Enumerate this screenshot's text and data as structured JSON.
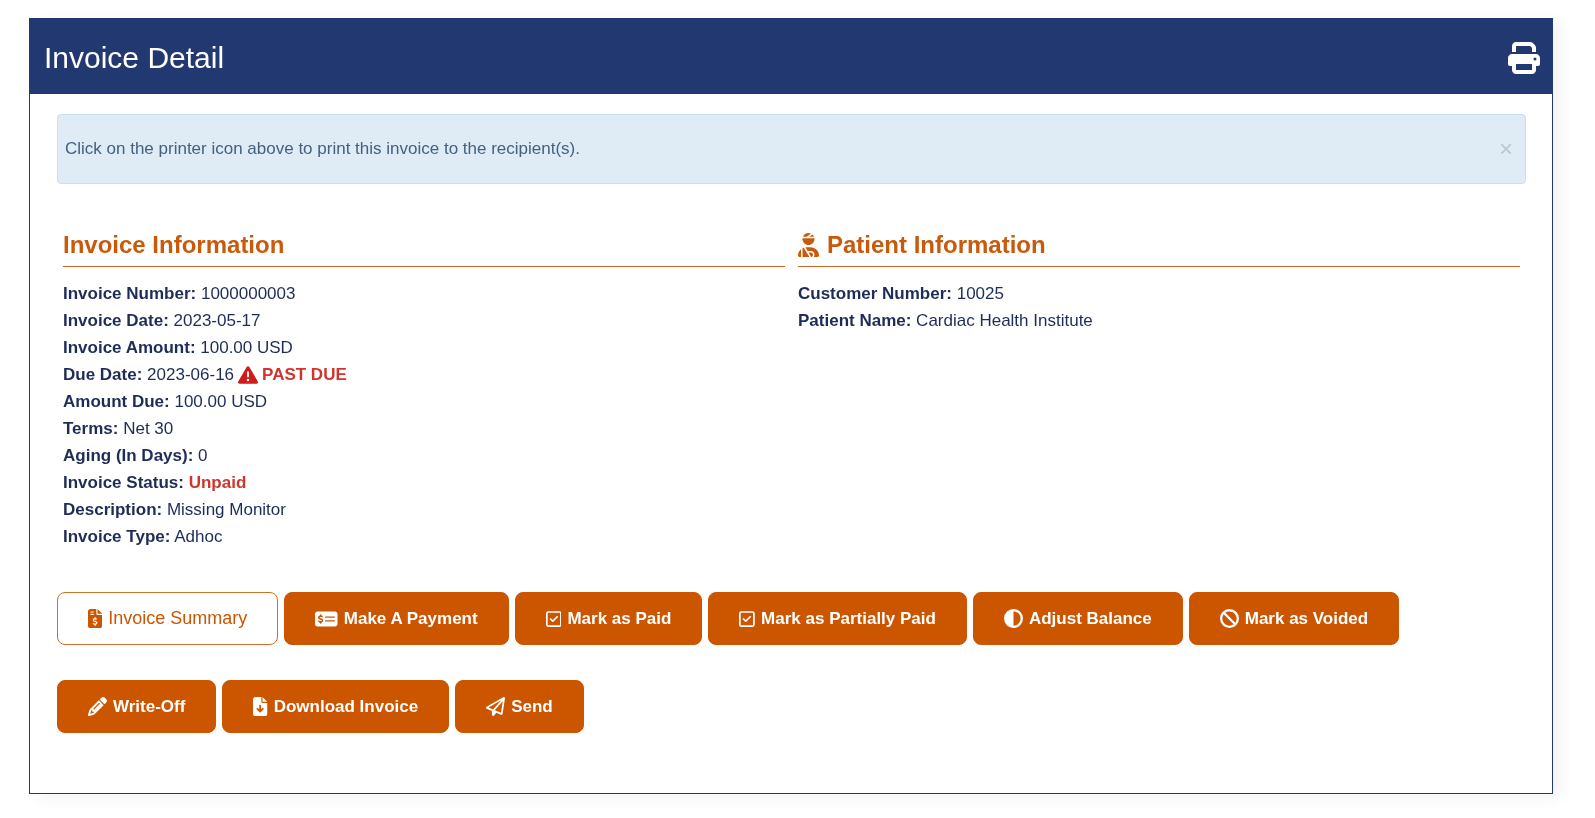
{
  "header": {
    "title": "Invoice Detail"
  },
  "alert": {
    "message": "Click on the printer icon above to print this invoice to the recipient(s).",
    "close": "×"
  },
  "sections": [
    {
      "kind": "invoice",
      "title": "Invoice Information",
      "fields": [
        {
          "kind": "text",
          "label": "Invoice Number:",
          "value": "1000000003"
        },
        {
          "kind": "text",
          "label": "Invoice Date:",
          "value": "2023-05-17"
        },
        {
          "kind": "text",
          "label": "Invoice Amount:",
          "value": "100.00 USD"
        },
        {
          "kind": "overdue",
          "label": "Due Date:",
          "value": "2023-06-16",
          "note": "PAST DUE"
        },
        {
          "kind": "text",
          "label": "Amount Due:",
          "value": "100.00 USD"
        },
        {
          "kind": "text",
          "label": "Terms:",
          "value": "Net 30"
        },
        {
          "kind": "text",
          "label": "Aging (In Days):",
          "value": "0"
        },
        {
          "kind": "status",
          "label": "Invoice Status:",
          "value": "Unpaid"
        },
        {
          "kind": "text",
          "label": "Description:",
          "value": "Missing Monitor"
        },
        {
          "kind": "text",
          "label": "Invoice Type:",
          "value": "Adhoc"
        }
      ]
    },
    {
      "kind": "patient",
      "title": "Patient Information",
      "fields": [
        {
          "kind": "text",
          "label": "Customer Number:",
          "value": "10025"
        },
        {
          "kind": "text",
          "label": "Patient Name:",
          "value": "Cardiac Health Institute"
        }
      ]
    }
  ],
  "action_rows": [
    {
      "buttons": [
        {
          "kind": "outline",
          "label": "Invoice Summary"
        },
        {
          "kind": "solid",
          "label": "Make A Payment"
        },
        {
          "kind": "solid",
          "label": "Mark as Paid"
        },
        {
          "kind": "solid",
          "label": "Mark as Partially Paid"
        },
        {
          "kind": "solid",
          "label": "Adjust Balance"
        },
        {
          "kind": "solid",
          "label": "Mark as Voided"
        }
      ]
    },
    {
      "buttons": [
        {
          "kind": "solid",
          "label": "Write-Off"
        },
        {
          "kind": "solid",
          "label": "Download Invoice"
        },
        {
          "kind": "solid",
          "label": "Send"
        }
      ]
    }
  ]
}
